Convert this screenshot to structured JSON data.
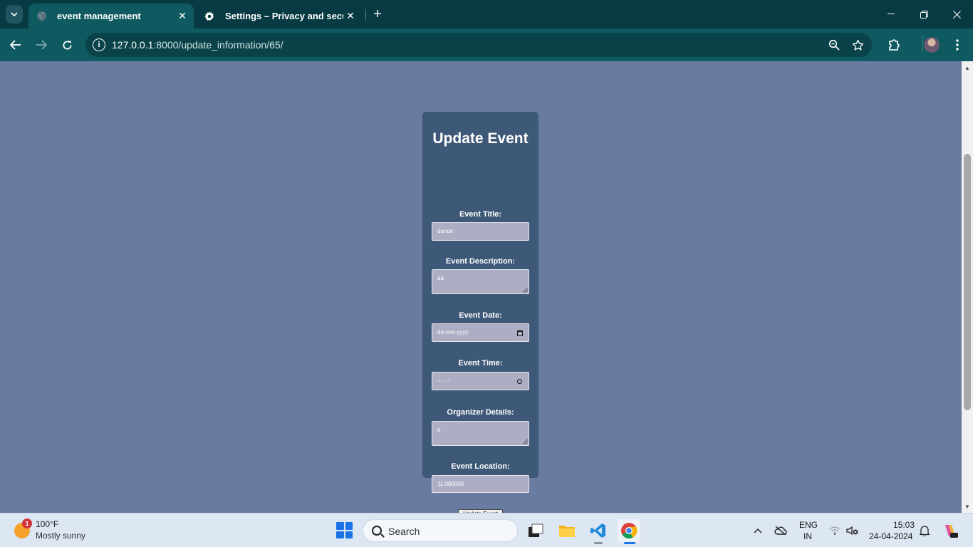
{
  "browser": {
    "tabs": [
      {
        "title": "event management",
        "active": true,
        "icon": "globe-icon"
      },
      {
        "title": "Settings – Privacy and security",
        "active": false,
        "icon": "gear-icon"
      }
    ],
    "url_host": "127.0.0.1",
    "url_rest": ":8000/update_information/65/"
  },
  "form": {
    "heading": "Update Event",
    "title_label": "Event Title:",
    "title_value": "dance",
    "description_label": "Event Description:",
    "description_value": "aa",
    "date_label": "Event Date:",
    "date_placeholder": "dd-mm-yyyy",
    "time_label": "Event Time:",
    "time_placeholder": "-- : --",
    "organizer_label": "Organizer Details:",
    "organizer_value": "a",
    "location_label": "Event Location:",
    "location_value": "11.000000",
    "submit_label": "Update Event"
  },
  "colors": {
    "page_bg": "#6a7ba2",
    "card_bg": "#3e5878",
    "input_bg": "#adadc3",
    "tab_bar": "#073a43",
    "toolbar": "#0e5a60"
  },
  "taskbar": {
    "weather_temp": "100°F",
    "weather_condition": "Mostly sunny",
    "weather_badge": "1",
    "search_placeholder": "Search",
    "language": "ENG",
    "region": "IN",
    "time": "15:03",
    "date": "24-04-2024"
  }
}
